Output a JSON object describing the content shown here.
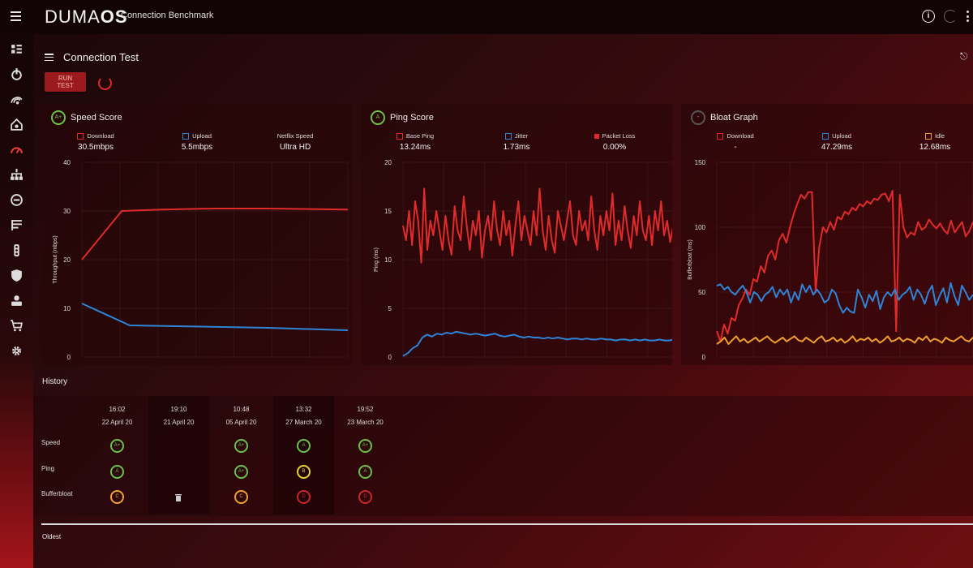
{
  "app": {
    "logo_a": "DUMA",
    "logo_b": "OS",
    "subtitle": "Connection Benchmark"
  },
  "page": {
    "title": "Connection Test",
    "run_button": "RUN TEST"
  },
  "speed": {
    "title": "Speed Score",
    "grade": "A+",
    "stats": [
      {
        "label": "Download",
        "value": "30.5mbps",
        "color": "#e02b2b"
      },
      {
        "label": "Upload",
        "value": "5.5mbps",
        "color": "#2f84d8"
      },
      {
        "label": "Netflix Speed",
        "value": "Ultra HD",
        "color": ""
      }
    ]
  },
  "ping": {
    "title": "Ping Score",
    "grade": "A",
    "stats": [
      {
        "label": "Base Ping",
        "value": "13.24ms",
        "color": "#e02b2b"
      },
      {
        "label": "Jitter",
        "value": "1.73ms",
        "color": "#2f84d8"
      },
      {
        "label": "Packet Loss",
        "value": "0.00%",
        "color": "#e02b2b"
      }
    ]
  },
  "bloat": {
    "title": "Bloat Graph",
    "grade": "-",
    "stats": [
      {
        "label": "Download",
        "value": "-",
        "color": "#e02b2b"
      },
      {
        "label": "Upload",
        "value": "47.29ms",
        "color": "#2f84d8"
      },
      {
        "label": "Idle",
        "value": "12.68ms",
        "color": "#f0a030"
      }
    ]
  },
  "history": {
    "title": "History",
    "row_labels": [
      "Speed",
      "Ping",
      "Bufferbloat"
    ],
    "oldest_label": "Oldest",
    "columns": [
      {
        "time": "16:02",
        "date": "22 April 20",
        "speed": "A+",
        "ping": "A",
        "bloat": "C"
      },
      {
        "time": "19:10",
        "date": "21 April 20",
        "speed": "",
        "ping": "",
        "bloat": "trash"
      },
      {
        "time": "10:48",
        "date": "05 April 20",
        "speed": "A+",
        "ping": "A+",
        "bloat": "C"
      },
      {
        "time": "13:32",
        "date": "27 March 20",
        "speed": "A",
        "ping": "B",
        "bloat": "D"
      },
      {
        "time": "19:52",
        "date": "23 March 20",
        "speed": "A+",
        "ping": "A",
        "bloat": "D"
      }
    ]
  },
  "colors": {
    "red": "#e02b2b",
    "blue": "#2f84d8",
    "orange": "#f0a030",
    "grade_green": "#6cc04a",
    "grade_yellow": "#e8d23a",
    "grade_orange": "#f0a030",
    "grade_red": "#c8262c"
  },
  "chart_data": [
    {
      "type": "line",
      "title": "Speed Score",
      "ylabel": "Throughput (mbps)",
      "ylim": [
        0,
        40
      ],
      "yticks": [
        0,
        10,
        20,
        30,
        40
      ],
      "series": [
        {
          "name": "Download",
          "color": "#e02b2b",
          "x": [
            0,
            0.15,
            0.3,
            0.5,
            0.7,
            1.0
          ],
          "y": [
            20,
            30,
            30.3,
            30.5,
            30.5,
            30.3
          ]
        },
        {
          "name": "Upload",
          "color": "#2f84d8",
          "x": [
            0,
            0.18,
            0.4,
            0.7,
            1.0
          ],
          "y": [
            11,
            6.5,
            6.3,
            6.0,
            5.5
          ]
        }
      ]
    },
    {
      "type": "line",
      "title": "Ping Score",
      "ylabel": "Ping (ms)",
      "ylim": [
        0,
        20
      ],
      "yticks": [
        0,
        5,
        10,
        15,
        20
      ],
      "series": [
        {
          "name": "Base Ping",
          "color": "#e02b2b",
          "y": [
            13.5,
            12,
            15,
            11.5,
            16,
            14,
            9.7,
            17.3,
            11,
            14,
            12.5,
            15,
            13,
            11,
            14.5,
            12,
            10.5,
            15.5,
            13,
            12,
            16.5,
            13.5,
            11,
            14,
            12.5,
            15,
            10.2,
            13,
            14.5,
            12,
            16,
            13,
            11.5,
            15,
            12.5,
            14,
            10.4,
            13.5,
            16,
            12,
            14.5,
            13,
            11.5,
            15,
            12.5,
            17.3,
            13,
            11,
            14.5,
            12,
            10.7,
            15,
            13.5,
            12,
            14,
            16,
            12.5,
            11.5,
            15,
            13,
            14,
            12,
            16.5,
            13,
            11,
            14.5,
            12.5,
            15,
            13,
            16.8,
            11.5,
            14,
            12,
            15.5,
            13,
            11.2,
            14.5,
            12.5,
            16,
            13,
            12,
            14.5,
            11.5,
            15,
            13,
            16,
            12.5,
            14,
            11.8,
            13.5,
            15,
            12,
            14,
            16,
            12.5
          ]
        },
        {
          "name": "Jitter",
          "color": "#2f84d8",
          "y": [
            0.1,
            0.4,
            0.9,
            1.2,
            2.0,
            2.3,
            2.1,
            2.4,
            2.3,
            2.5,
            2.4,
            2.6,
            2.5,
            2.4,
            2.3,
            2.4,
            2.3,
            2.2,
            2.3,
            2.4,
            2.2,
            2.1,
            2.2,
            2.3,
            2.1,
            2.0,
            2.1,
            2.0,
            2.0,
            1.9,
            2.0,
            1.9,
            2.0,
            1.9,
            1.8,
            1.9,
            1.9,
            1.8,
            1.9,
            1.8,
            1.8,
            1.9,
            1.8,
            1.8,
            1.7,
            1.8,
            1.8,
            1.7,
            1.8,
            1.7,
            1.8,
            1.7,
            1.7,
            1.8,
            1.7,
            1.7,
            1.8,
            1.7,
            1.7,
            1.7
          ]
        }
      ]
    },
    {
      "type": "line",
      "title": "Bloat Graph",
      "ylabel": "Bufferbloat (ms)",
      "ylim": [
        0,
        150
      ],
      "yticks": [
        0,
        50,
        100,
        150
      ],
      "series": [
        {
          "name": "Download",
          "color": "#e02b2b",
          "y": [
            20,
            12,
            25,
            18,
            30,
            28,
            40,
            45,
            52,
            48,
            60,
            58,
            70,
            65,
            78,
            82,
            75,
            90,
            95,
            88,
            100,
            110,
            118,
            125,
            122,
            127,
            127,
            50,
            85,
            100,
            96,
            104,
            98,
            108,
            106,
            112,
            110,
            115,
            113,
            118,
            116,
            120,
            118,
            122,
            121,
            125,
            126,
            120,
            128,
            20,
            125,
            100,
            92,
            96,
            94,
            104,
            98,
            100,
            106,
            102,
            99,
            103,
            98,
            95,
            105,
            96,
            100,
            104,
            93,
            97,
            104
          ],
          "note_x": "sample index"
        },
        {
          "name": "Upload",
          "color": "#2f84d8",
          "y": [
            55,
            56,
            52,
            54,
            50,
            48,
            52,
            55,
            50,
            42,
            50,
            48,
            43,
            48,
            50,
            54,
            46,
            52,
            48,
            52,
            42,
            50,
            44,
            56,
            50,
            55,
            48,
            52,
            48,
            42,
            44,
            52,
            49,
            40,
            34,
            38,
            35,
            34,
            52,
            46,
            38,
            48,
            43,
            51,
            37,
            46,
            50,
            47,
            52,
            44,
            48,
            50,
            54,
            44,
            52,
            48,
            41,
            50,
            55,
            40,
            47,
            53,
            42,
            57,
            47,
            40,
            55,
            50,
            44,
            48
          ],
          "note_x": "sample index"
        },
        {
          "name": "Idle",
          "color": "#f0a030",
          "y": [
            10,
            12,
            15,
            10,
            13,
            16,
            12,
            14,
            11,
            13,
            15,
            12,
            14,
            16,
            13,
            11,
            13,
            15,
            12,
            14,
            16,
            13,
            12,
            15,
            13,
            11,
            14,
            16,
            12,
            13,
            15,
            12,
            14,
            11,
            13,
            16,
            12,
            14,
            13,
            15,
            12,
            14,
            11,
            13,
            16,
            12,
            13,
            15,
            12,
            14,
            13,
            11,
            15,
            13,
            16,
            12,
            14,
            13,
            11,
            15,
            13,
            12,
            14,
            16,
            13,
            12,
            15
          ]
        }
      ]
    }
  ]
}
